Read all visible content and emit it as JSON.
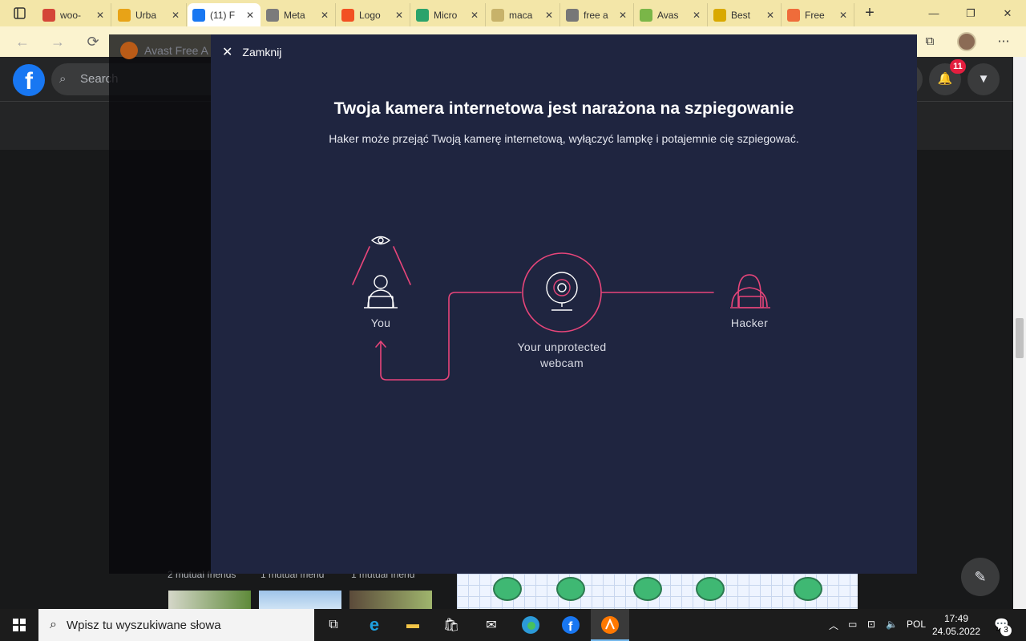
{
  "browser": {
    "tabs": [
      {
        "title": "woo-",
        "favicon": "gmail-icon",
        "color": "#d44638"
      },
      {
        "title": "Urba",
        "favicon": "urban-dictionary-icon",
        "color": "#e8a317"
      },
      {
        "title": "(11) F",
        "favicon": "facebook-icon",
        "color": "#1877f2",
        "active": true
      },
      {
        "title": "Meta",
        "favicon": "meta-icon",
        "color": "#7b7b7b"
      },
      {
        "title": "Logo",
        "favicon": "microsoft-icon",
        "color": "#f25022"
      },
      {
        "title": "Micro",
        "favicon": "edge-icon",
        "color": "#2ba36b"
      },
      {
        "title": "maca",
        "favicon": "bing-icon",
        "color": "#c7b26a"
      },
      {
        "title": "free a",
        "favicon": "search-icon",
        "color": "#777777"
      },
      {
        "title": "Avas",
        "favicon": "dp-icon",
        "color": "#7ab648"
      },
      {
        "title": "Best",
        "favicon": "ten-icon",
        "color": "#d9a900"
      },
      {
        "title": "Free",
        "favicon": "shield-icon",
        "color": "#ef6c3a"
      }
    ],
    "tab_close_glyph": "✕",
    "new_tab_glyph": "+"
  },
  "facebook": {
    "search_placeholder": "Search",
    "logo_letter": "f",
    "notification_count": "11",
    "mutual_friends": [
      "2 mutual friends",
      "1 mutual friend",
      "1 mutual friend"
    ]
  },
  "avast": {
    "app_title": "Avast Free A",
    "close_label": "Zamknij",
    "headline": "Twoja kamera internetowa jest narażona na szpiegowanie",
    "subline": "Haker może przejąć Twoją kamerę internetową, wyłączyć lampkę i potajemnie cię szpiegować.",
    "diagram": {
      "you_label": "You",
      "webcam_label_line1": "Your unprotected",
      "webcam_label_line2": "webcam",
      "hacker_label": "Hacker",
      "accent_color": "#e8457a"
    }
  },
  "taskbar": {
    "search_placeholder": "Wpisz tu wyszukiwane słowa",
    "language": "POL",
    "time": "17:49",
    "date": "24.05.2022",
    "notification_count": "3"
  }
}
